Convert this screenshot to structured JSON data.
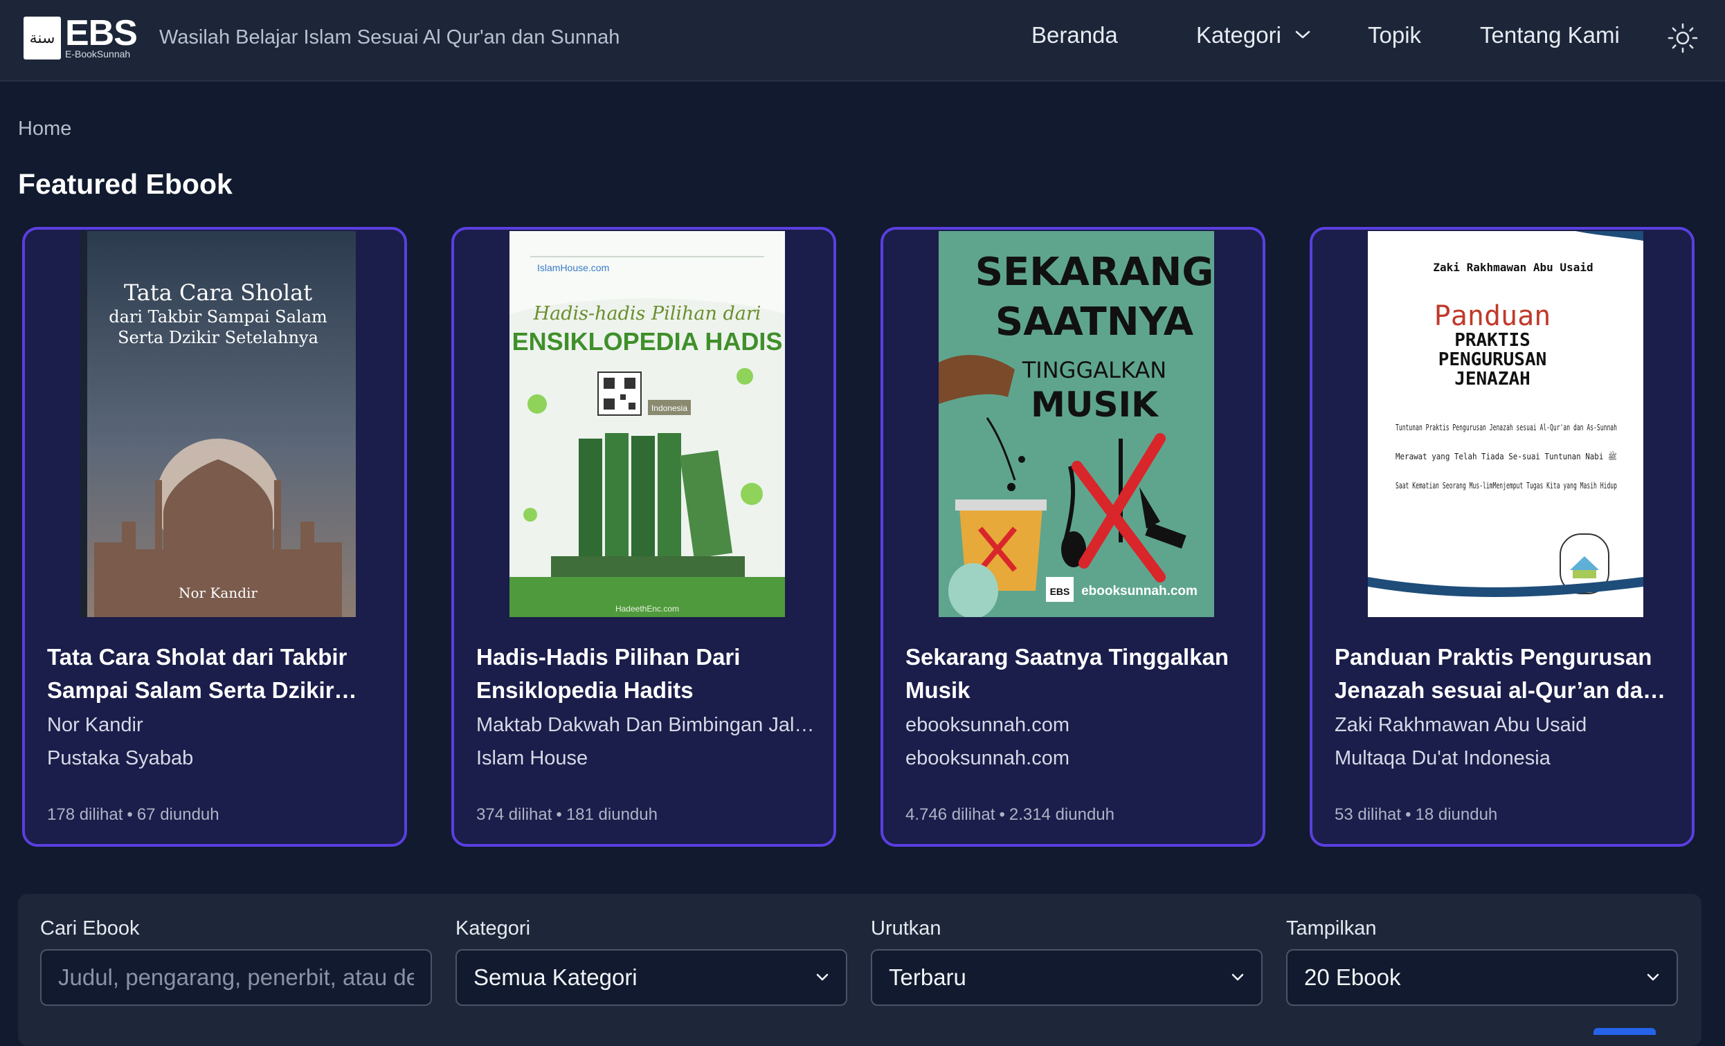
{
  "header": {
    "logo_arabic": "سنة",
    "logo_word": "EBS",
    "logo_sub": "E-BookSunnah",
    "tagline": "Wasilah Belajar Islam Sesuai Al Qur'an dan Sunnah",
    "nav": {
      "beranda": "Beranda",
      "kategori": "Kategori",
      "topik": "Topik",
      "tentang": "Tentang Kami"
    },
    "theme_icon": "sun-icon"
  },
  "breadcrumb": "Home",
  "section_title": "Featured Ebook",
  "cards": [
    {
      "title": "Tata Cara Sholat dari Takbir Sampai Salam Serta Dzikir Setelahnya",
      "author": "Nor Kandir",
      "publisher": "Pustaka Syabab",
      "views": "178 dilihat",
      "downloads": "67 diunduh",
      "cover": {
        "line1": "Tata Cara Sholat",
        "line2": "dari Takbir Sampai Salam",
        "line3": "Serta Dzikir Setelahnya",
        "author": "Nor Kandir"
      }
    },
    {
      "title": "Hadis-Hadis Pilihan Dari Ensiklopedia Hadits",
      "author": "Maktab Dakwah Dan Bimbingan Jaliyat Rabwah",
      "publisher": "Islam House",
      "views": "374 dilihat",
      "downloads": "181 diunduh",
      "cover": {
        "top": "IslamHouse.com",
        "line1": "Hadis-hadis Pilihan dari",
        "line2": "ENSIKLOPEDIA HADIS",
        "tag": "Indonesia",
        "bottom": "HadeethEnc.com"
      }
    },
    {
      "title": "Sekarang Saatnya Tinggalkan Musik",
      "author": "ebooksunnah.com",
      "publisher": "ebooksunnah.com",
      "views": "4.746 dilihat",
      "downloads": "2.314 diunduh",
      "cover": {
        "line1": "SEKARANG",
        "line2": "SAATNYA",
        "line3": "TINGGALKAN",
        "line4": "MUSIK",
        "brand": "EBS",
        "site": "ebooksunnah.com"
      }
    },
    {
      "title": "Panduan Praktis Pengurusan Jenazah sesuai al-Qur’an dan Sunnah",
      "author": "Zaki Rakhmawan Abu Usaid",
      "publisher": "Multaqa Du'at Indonesia",
      "views": "53 dilihat",
      "downloads": "18 diunduh",
      "cover": {
        "author": "Zaki Rakhmawan Abu Usaid",
        "line1": "Panduan",
        "line2": "PRAKTIS",
        "line3": "PENGURUSAN",
        "line4": "JENAZAH",
        "bullet1": "Tuntunan Praktis Pengurusan Jenazah sesuai Al-Qur'an dan As-Sunnah",
        "bullet2": "Merawat yang Telah Tiada Se-suai Tuntunan Nabi ﷺ",
        "bullet3": "Saat Kematian Seorang Mus-limMenjemput Tugas Kita yang Masih Hidup"
      }
    }
  ],
  "filters": {
    "search": {
      "label": "Cari Ebook",
      "placeholder": "Judul, pengarang, penerbit, atau deskripsi..."
    },
    "kategori": {
      "label": "Kategori",
      "value": "Semua Kategori"
    },
    "urutkan": {
      "label": "Urutkan",
      "value": "Terbaru"
    },
    "tampilkan": {
      "label": "Tampilkan",
      "value": "20 Ebook"
    }
  },
  "colors": {
    "background": "#111a2e",
    "header": "#1c2638",
    "card": "#1b1d4a",
    "card_border": "#5a3fe0",
    "panel": "#1d2739"
  }
}
